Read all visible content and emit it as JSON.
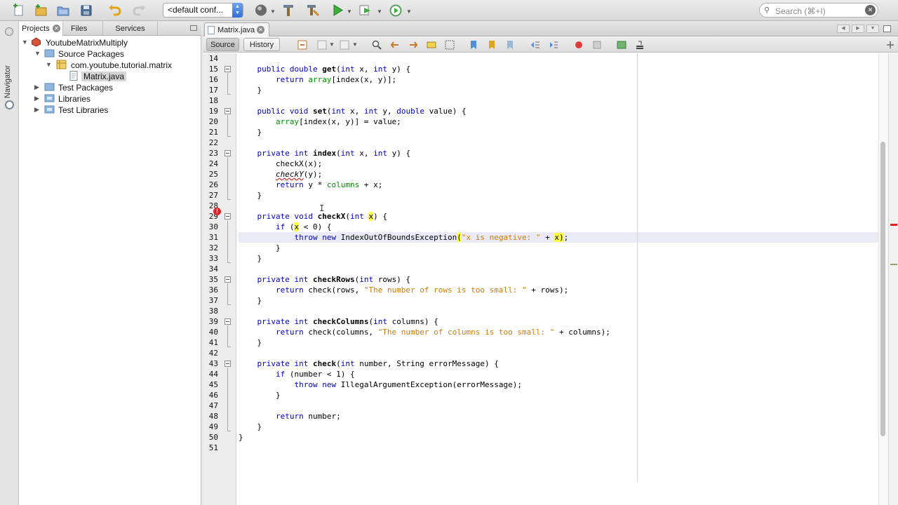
{
  "toolbar": {
    "config_value": "<default conf...",
    "search_placeholder": "Search (⌘+I)"
  },
  "side": {
    "navigator_label": "Navigator"
  },
  "panel": {
    "tabs": [
      {
        "label": "Projects"
      },
      {
        "label": "Files"
      },
      {
        "label": "Services"
      }
    ],
    "tree": [
      {
        "label": "YoutubeMatrixMultiply"
      },
      {
        "label": "Source Packages"
      },
      {
        "label": "com.youtube.tutorial.matrix"
      },
      {
        "label": "Matrix.java"
      },
      {
        "label": "Test Packages"
      },
      {
        "label": "Libraries"
      },
      {
        "label": "Test Libraries"
      }
    ]
  },
  "editor": {
    "file_tab": "Matrix.java",
    "source_label": "Source",
    "history_label": "History",
    "line_numbers": [
      "14",
      "15",
      "16",
      "17",
      "18",
      "19",
      "20",
      "21",
      "22",
      "23",
      "24",
      "25",
      "26",
      "27",
      "28",
      "29",
      "30",
      "31",
      "32",
      "33",
      "34",
      "35",
      "36",
      "37",
      "38",
      "39",
      "40",
      "41",
      "42",
      "43",
      "44",
      "45",
      "46",
      "47",
      "48",
      "49",
      "50",
      "51"
    ],
    "code": {
      "l15": {
        "a": "    ",
        "k1": "public double ",
        "f": "get",
        "b": "(",
        "k2": "int",
        "c": " x, ",
        "k3": "int",
        "d": " y) {"
      },
      "l16": {
        "k": "        return ",
        "fld": "array",
        "rest": "[index(x, y)];"
      },
      "l17": "    }",
      "l19": {
        "k1": "    public void ",
        "f": "set",
        "b": "(",
        "k2": "int",
        "c": " x, ",
        "k3": "int",
        "d": " y, ",
        "k4": "double",
        "e": " value) {"
      },
      "l20": {
        "pre": "        ",
        "fld": "array",
        "rest": "[index(x, y)] = value;"
      },
      "l21": "    }",
      "l23": {
        "k1": "    private int ",
        "f": "index",
        "b": "(",
        "k2": "int",
        "c": " x, ",
        "k3": "int",
        "d": " y) {"
      },
      "l24": "        checkX(x);",
      "l25": {
        "pre": "        ",
        "err": "checkY",
        "rest": "(y);"
      },
      "l26": {
        "k": "        return ",
        "a": "y * ",
        "fld": "columns",
        "rest": " + x;"
      },
      "l27": "    }",
      "l29": {
        "k1": "    private void ",
        "f": "checkX",
        "b": "(",
        "k2": "int",
        "c": " ",
        "hl": "x",
        "d": ") {"
      },
      "l30": {
        "k": "        if ",
        "a": "(",
        "hl": "x",
        "rest": " < 0) {"
      },
      "l31": {
        "k": "            throw new ",
        "a": "IndexOutOfBoundsException",
        "p1": "(",
        "str": "\"x is negative: \"",
        "b": " + ",
        "hl": "x",
        "p2": ")",
        "rest": ";"
      },
      "l32": "        }",
      "l33": "    }",
      "l35": {
        "k1": "    private int ",
        "f": "checkRows",
        "b": "(",
        "k2": "int",
        "c": " rows) {"
      },
      "l36": {
        "k": "        return ",
        "a": "check(rows, ",
        "str": "\"The number of rows is too small: \"",
        "rest": " + rows);"
      },
      "l37": "    }",
      "l39": {
        "k1": "    private int ",
        "f": "checkColumns",
        "b": "(",
        "k2": "int",
        "c": " columns) {"
      },
      "l40": {
        "k": "        return ",
        "a": "check(columns, ",
        "str": "\"The number of columns is too small: \"",
        "rest": " + columns);"
      },
      "l41": "    }",
      "l43": {
        "k1": "    private int ",
        "f": "check",
        "b": "(",
        "k2": "int",
        "c": " number, String errorMessage) {"
      },
      "l44": {
        "k": "        if ",
        "rest": "(number < 1) {"
      },
      "l45": {
        "k": "            throw new ",
        "rest": "IllegalArgumentException(errorMessage);"
      },
      "l46": "        }",
      "l48": {
        "k": "        return ",
        "rest": "number;"
      },
      "l49": "    }",
      "l50": "}"
    }
  },
  "colors": {
    "keyword": "#0000cc",
    "field": "#009000",
    "string": "#ce7b00",
    "highlight": "#ffff44",
    "error": "#e0201f"
  }
}
